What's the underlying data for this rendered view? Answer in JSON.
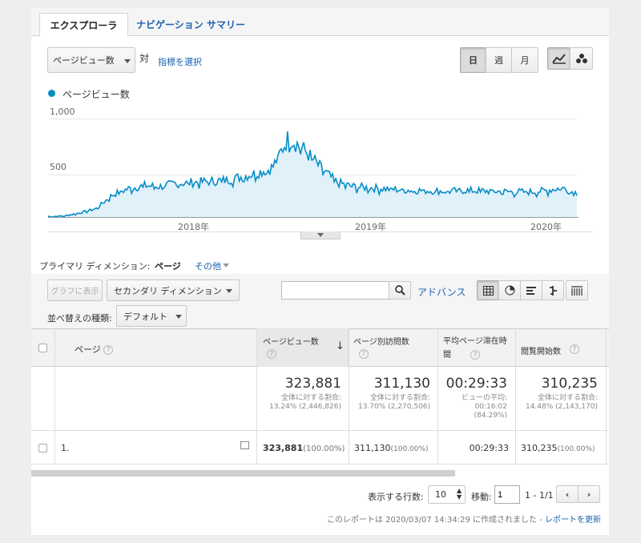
{
  "tabs": [
    {
      "label": "エクスプローラ"
    },
    {
      "label": "ナビゲーション サマリー"
    }
  ],
  "metric_select": {
    "value": "ページビュー数",
    "vs_label": "対",
    "select_metric_link": "指標を選択"
  },
  "period_buttons": [
    {
      "label": "日"
    },
    {
      "label": "週"
    },
    {
      "label": "月"
    }
  ],
  "chart": {
    "legend": "ページビュー数",
    "y_ticks": [
      "1,000",
      "500"
    ],
    "x_ticks": [
      "2018年",
      "2019年",
      "2020年"
    ],
    "series_color": "#058dc7",
    "fill_color": "#e1f1f9"
  },
  "chart_data": {
    "type": "area",
    "series": [
      {
        "name": "ページビュー数"
      }
    ],
    "ylim": [
      0,
      1000
    ],
    "x_ticks": [
      "2018年",
      "2019年",
      "2020年"
    ],
    "y_ticks": [
      500,
      1000
    ],
    "x_start": "2017-05",
    "x_end": "2020-03",
    "values_monthly": [
      5,
      10,
      40,
      80,
      210,
      270,
      300,
      290,
      320,
      330,
      340,
      350,
      380,
      420,
      470,
      760,
      640,
      470,
      330,
      290,
      280,
      270,
      260,
      255,
      250,
      245,
      255,
      250,
      245,
      240,
      240,
      250,
      280,
      230
    ]
  },
  "dimension": {
    "label": "プライマリ ディメンション:",
    "current": "ページ",
    "other": "その他"
  },
  "toolbar": {
    "graph_button": "グラフに表示",
    "secondary_dimension": "セカンダリ ディメンション",
    "search_placeholder": "",
    "advanced": "アドバンス",
    "sort_label": "並べ替えの種類:",
    "sort_value": "デフォルト"
  },
  "table": {
    "headers": {
      "page": "ページ",
      "pageviews": "ページビュー数",
      "unique": "ページ別訪問数",
      "avg_time": "平均ページ滞在時間",
      "entrances": "閲覧開始数"
    },
    "totals": {
      "pageviews": "323,881",
      "pageviews_pct": "全体に対する割合:",
      "pageviews_sub": "13.24% (2,446,826)",
      "unique": "311,130",
      "unique_pct": "全体に対する割合:",
      "unique_sub": "13.70% (2,270,506)",
      "avg_time": "00:29:33",
      "avg_time_label": "ビューの平均:",
      "avg_time_sub": "00:16:02",
      "avg_time_sub2": "(84.29%)",
      "entrances": "310,235",
      "entrances_pct": "全体に対する割合:",
      "entrances_sub": "14.48% (2,143,170)"
    },
    "rows": [
      {
        "index": "1.",
        "pageviews": "323,881",
        "pageviews_pct": "(100.00%)",
        "unique": "311,130",
        "unique_pct": "(100.00%)",
        "avg_time": "00:29:33",
        "entrances": "310,235",
        "entrances_pct": "(100.00%)"
      }
    ]
  },
  "footer": {
    "rows_label": "表示する行数:",
    "rows_value": "10",
    "goto_label": "移動:",
    "goto_value": "1",
    "range": "1 - 1/1",
    "report_text": "このレポートは 2020/03/07 14:34:29 に作成されました - ",
    "refresh_link": "レポートを更新"
  }
}
